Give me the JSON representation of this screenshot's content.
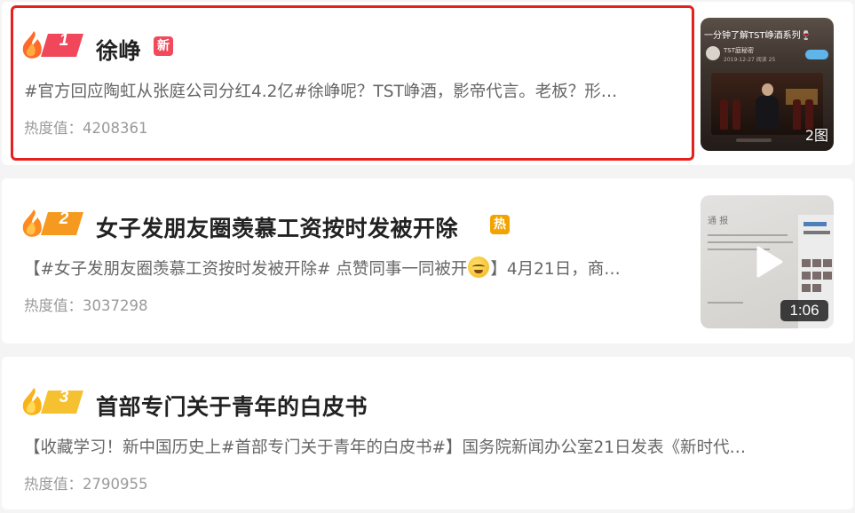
{
  "items": [
    {
      "rank": "1",
      "title": "徐峥",
      "badge": "新",
      "summary": "#官方回应陶虹从张庭公司分红4.2亿#徐峥呢？TST峥酒，影帝代言。老板？形…",
      "heat": "热度值：4208361",
      "thumb": {
        "kind": "image",
        "label": "2图",
        "header": "一分钟了解TST峥酒系列🍷",
        "account_name": "TST庭秘密",
        "account_date": "2019-12-27  阅读 25"
      }
    },
    {
      "rank": "2",
      "title": "女子发朋友圈羡慕工资按时发被开除",
      "badge": "热",
      "summary_before": "【#女子发朋友圈羡慕工资按时发被开除# 点赞同事一同被开",
      "summary_after": "】4月21日，商…",
      "emoji_icon": "sweat-smile-emoji",
      "heat": "热度值：3037298",
      "thumb": {
        "kind": "video",
        "duration": "1:06",
        "doc_title": "通 报"
      }
    },
    {
      "rank": "3",
      "title": "首部专门关于青年的白皮书",
      "summary": "【收藏学习！新中国历史上#首部专门关于青年的白皮书#】国务院新闻办公室21日发表《新时代…",
      "heat": "热度值：2790955"
    }
  ],
  "colors": {
    "highlight_border": "#e4211d",
    "rank1_flag": "#f0475a",
    "rank2_flag": "#f59a1e",
    "rank3_flag": "#f6c130",
    "badge_new": "#f04a5c",
    "badge_hot": "#f2a300",
    "title_text": "#222222",
    "summary_text": "#666666",
    "heat_text": "#9a9a9a"
  },
  "icons": {
    "rank": "flame-flag-icon",
    "video": "play-icon"
  }
}
